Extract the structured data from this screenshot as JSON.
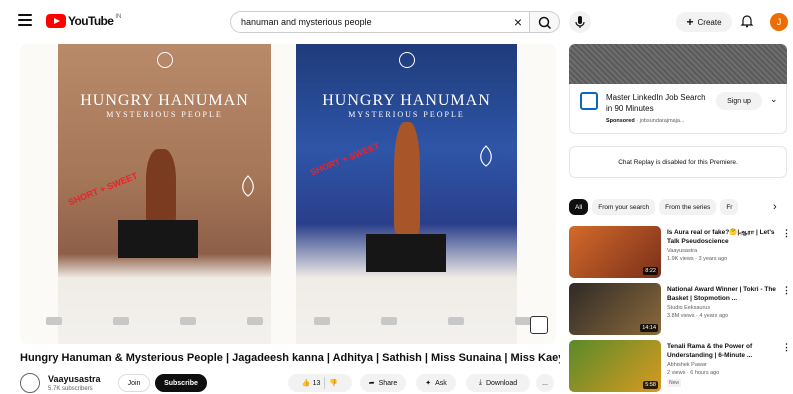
{
  "app": {
    "logo_text": "YouTube",
    "logo_region": "IN"
  },
  "search": {
    "query": "hanuman and mysterious people"
  },
  "header": {
    "create_label": "Create",
    "avatar_initial": "J"
  },
  "player": {
    "poster_left": {
      "title": "HUNGRY HANUMAN",
      "subtitle": "MYSTERIOUS PEOPLE",
      "ribbon": "SHORT + SWEET"
    },
    "poster_right": {
      "title": "HUNGRY HANUMAN",
      "subtitle": "MYSTERIOUS PEOPLE",
      "ribbon": "SHORT + SWEET"
    }
  },
  "video": {
    "title": "Hungry Hanuman & Mysterious People | Jagadeesh kanna | Adhitya | Sathish | Miss Sunaina | Miss Kaeya",
    "channel_name": "Vaayusastra",
    "subscribers": "5.7K subscribers",
    "join_label": "Join",
    "subscribe_label": "Subscribe",
    "like_count": "13",
    "share_label": "Share",
    "ask_label": "Ask",
    "download_label": "Download",
    "more_label": "..."
  },
  "ad": {
    "title": "Master LinkedIn Job Search in 90 Minutes",
    "sponsored_label": "Sponsored",
    "sponsored_url": "· jobsundarajmaja...",
    "signup_label": "Sign up"
  },
  "chat": {
    "notice": "Chat Replay is disabled for this Premiere."
  },
  "chips": [
    "All",
    "From your search",
    "From the series",
    "Fr"
  ],
  "recommendations": [
    {
      "title": "Is Aura real or fake?🤔|ஆரா | Let's Talk Pseudoscience",
      "channel": "Vaayusastra",
      "meta": "1.9K views · 3 years ago",
      "duration": "8:22",
      "badge": ""
    },
    {
      "title": "National Award Winner | Tokri - The Basket | Stopmotion ...",
      "channel": "Studio Eeksaurus",
      "meta": "3.8M views · 4 years ago",
      "duration": "14:14",
      "badge": ""
    },
    {
      "title": "Tenali Rama & the Power of Understanding | 6-Minute ...",
      "channel": "Abhishek Pawar",
      "meta": "2 views · 6 hours ago",
      "duration": "5:58",
      "badge": "New"
    }
  ],
  "colors": {
    "brand_red": "#ff0000",
    "avatar_orange": "#ef6c00",
    "linkedin_blue": "#0a66c2"
  }
}
